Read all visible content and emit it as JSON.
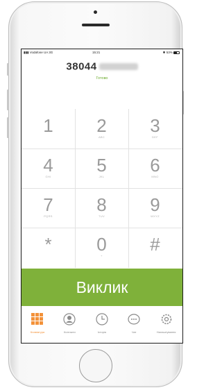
{
  "status_bar": {
    "carrier": "Vodafone UA",
    "network": "3G",
    "time": "15:21",
    "battery": "53%"
  },
  "dialer": {
    "number": "38044",
    "done_label": "Готово"
  },
  "keypad": [
    {
      "digit": "1",
      "letters": ""
    },
    {
      "digit": "2",
      "letters": "ABC"
    },
    {
      "digit": "3",
      "letters": "DEF"
    },
    {
      "digit": "4",
      "letters": "GHI"
    },
    {
      "digit": "5",
      "letters": "JKL"
    },
    {
      "digit": "6",
      "letters": "MNO"
    },
    {
      "digit": "7",
      "letters": "PQRS"
    },
    {
      "digit": "8",
      "letters": "TUV"
    },
    {
      "digit": "9",
      "letters": "WXYZ"
    },
    {
      "digit": "*",
      "letters": ""
    },
    {
      "digit": "0",
      "letters": "+"
    },
    {
      "digit": "#",
      "letters": ""
    }
  ],
  "call_button": {
    "label": "Виклик"
  },
  "tabs": [
    {
      "label": "Клавіатура",
      "icon": "keypad-grid-icon",
      "active": true
    },
    {
      "label": "Контакти",
      "icon": "contacts-icon",
      "active": false
    },
    {
      "label": "Історія",
      "icon": "clock-icon",
      "active": false
    },
    {
      "label": "Чат",
      "icon": "chat-bubble-icon",
      "active": false
    },
    {
      "label": "Налаштування",
      "icon": "settings-gear-icon",
      "active": false
    }
  ],
  "colors": {
    "accent_green": "#7fb13a",
    "active_tab_orange": "#f3923a",
    "done_green": "#6cab2e",
    "key_gray": "#9a9a9a"
  }
}
